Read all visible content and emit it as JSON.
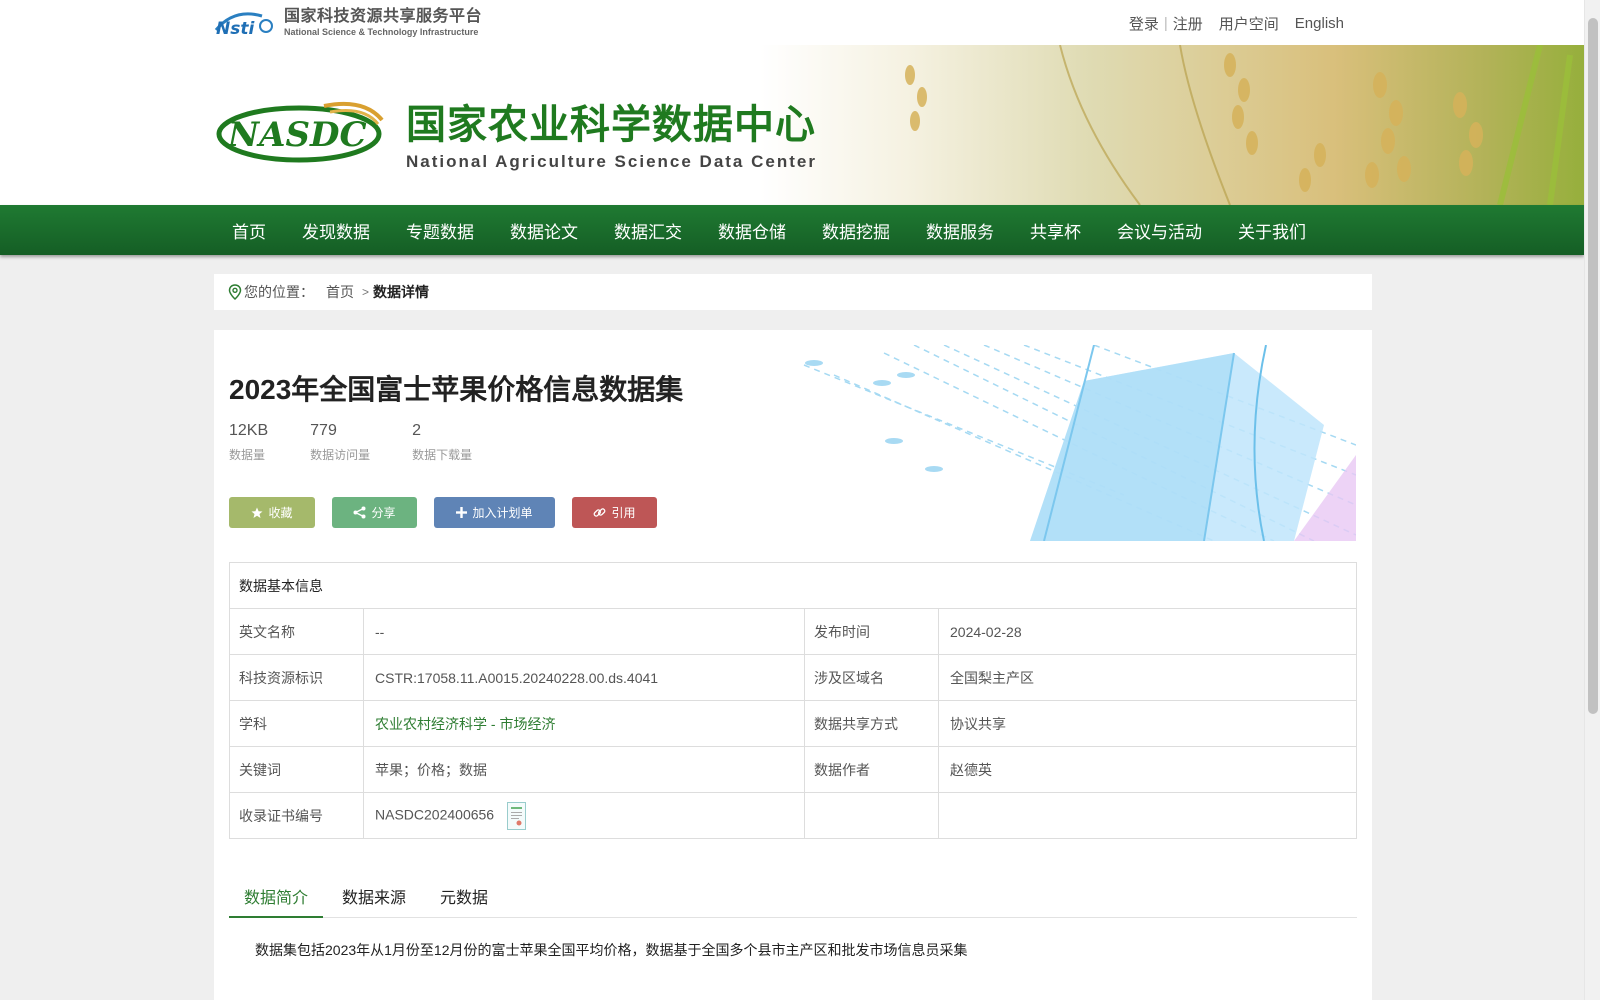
{
  "header": {
    "platform_cn": "国家科技资源共享服务平台",
    "platform_en": "National Science & Technology Infrastructure",
    "links": {
      "login": "登录",
      "register": "注册",
      "user_space": "用户空间",
      "english": "English"
    }
  },
  "banner": {
    "title_cn": "国家农业科学数据中心",
    "title_en": "National Agriculture Science Data Center"
  },
  "nav": {
    "items": [
      "首页",
      "发现数据",
      "专题数据",
      "数据论文",
      "数据汇交",
      "数据仓储",
      "数据挖掘",
      "数据服务",
      "共享杯",
      "会议与活动",
      "关于我们"
    ]
  },
  "breadcrumb": {
    "prefix": "您的位置：",
    "home": "首页",
    "current": "数据详情"
  },
  "dataset": {
    "title": "2023年全国富士苹果价格信息数据集",
    "stats": [
      {
        "value": "12KB",
        "label": "数据量"
      },
      {
        "value": "779",
        "label": "数据访问量"
      },
      {
        "value": "2",
        "label": "数据下载量"
      }
    ],
    "buttons": {
      "favorite": "收藏",
      "share": "分享",
      "add_plan": "加入计划单",
      "cite": "引用"
    }
  },
  "info_table": {
    "heading": "数据基本信息",
    "rows": [
      {
        "k1": "英文名称",
        "v1": "--",
        "k2": "发布时间",
        "v2": "2024-02-28"
      },
      {
        "k1": "科技资源标识",
        "v1": "CSTR:17058.11.A0015.20240228.00.ds.4041",
        "k2": "涉及区域名",
        "v2": "全国梨主产区"
      },
      {
        "k1": "学科",
        "v1": "农业农村经济科学 - 市场经济",
        "k2": "数据共享方式",
        "v2": "协议共享"
      },
      {
        "k1": "关键词",
        "v1": "苹果；价格；数据",
        "k2": "数据作者",
        "v2": "赵德英"
      },
      {
        "k1": "收录证书编号",
        "v1": "NASDC202400656",
        "k2": "",
        "v2": ""
      }
    ]
  },
  "tabs": {
    "items": [
      "数据简介",
      "数据来源",
      "元数据"
    ],
    "active": "数据简介"
  },
  "description": "数据集包括2023年从1月份至12月份的富士苹果全国平均价格，数据基于全国多个县市主产区和批发市场信息员采集",
  "colors": {
    "nav_green": "#1f7a32",
    "accent_green": "#2e7d32",
    "btn_favorite": "#a5b96b",
    "btn_share": "#6cb380",
    "btn_plan": "#5f84b6",
    "btn_cite": "#be5656"
  }
}
